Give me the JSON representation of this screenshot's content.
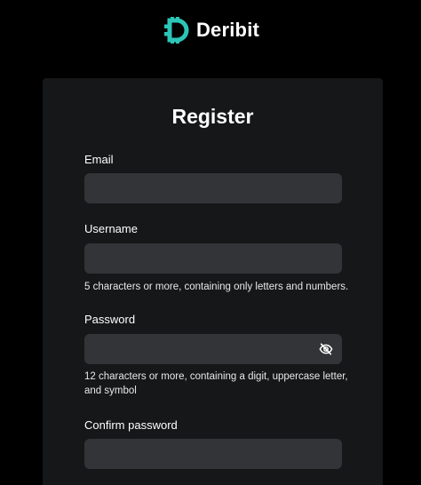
{
  "brand": {
    "name": "Deribit",
    "logo_icon": "deribit-logo-icon",
    "accent_color": "#2cc5b8"
  },
  "form": {
    "title": "Register",
    "email": {
      "label": "Email",
      "value": "",
      "placeholder": ""
    },
    "username": {
      "label": "Username",
      "value": "",
      "placeholder": "",
      "hint": "5 characters or more, containing only letters and numbers."
    },
    "password": {
      "label": "Password",
      "value": "",
      "placeholder": "",
      "hint_line1": "12 characters or more, containing a digit, uppercase letter,",
      "hint_line2": "and symbol",
      "toggle_icon": "eye-off-icon"
    },
    "confirm_password": {
      "label": "Confirm password",
      "value": "",
      "placeholder": ""
    }
  },
  "colors": {
    "background": "#000000",
    "card": "#151718",
    "input": "#323437",
    "text": "#ffffff"
  }
}
